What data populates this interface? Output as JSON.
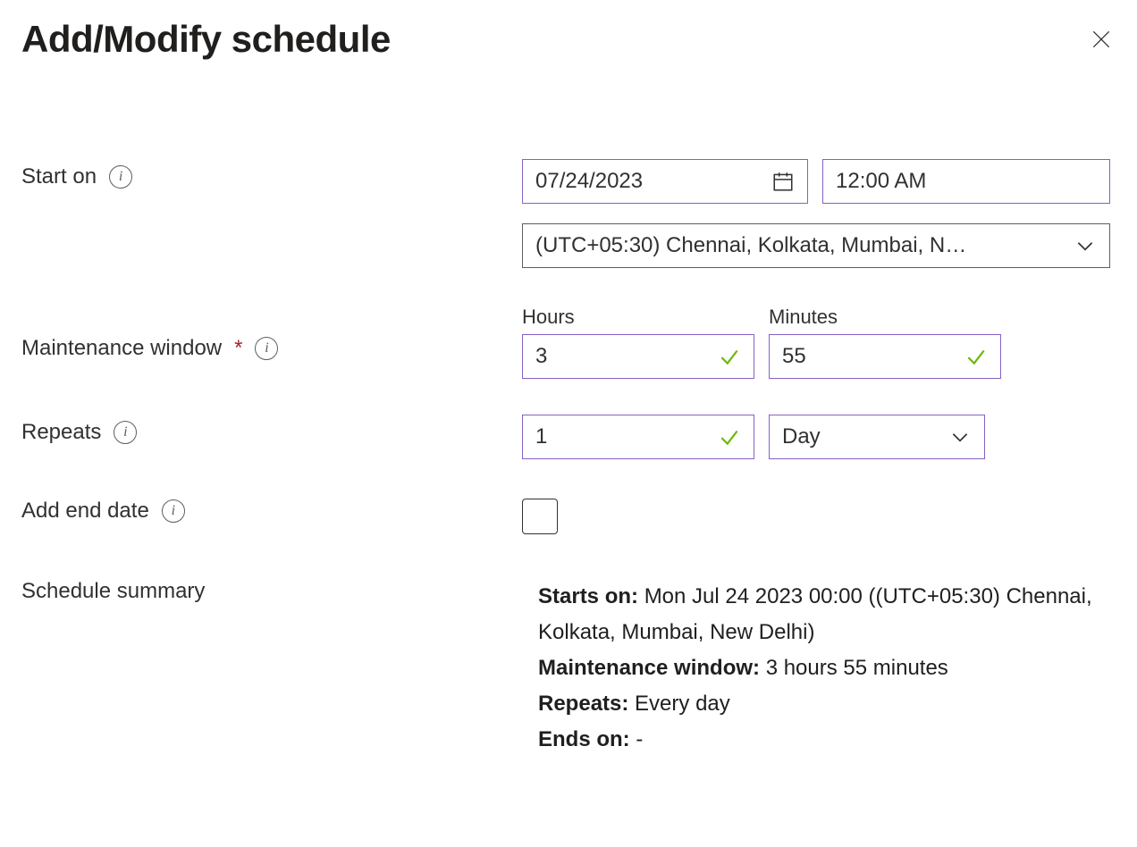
{
  "title": "Add/Modify schedule",
  "labels": {
    "start_on": "Start on",
    "maintenance_window": "Maintenance window",
    "repeats": "Repeats",
    "add_end_date": "Add end date",
    "schedule_summary": "Schedule summary",
    "hours": "Hours",
    "minutes": "Minutes",
    "required_marker": "*"
  },
  "values": {
    "date": "07/24/2023",
    "time": "12:00 AM",
    "timezone": "(UTC+05:30) Chennai, Kolkata, Mumbai, N…",
    "hours": "3",
    "minutes": "55",
    "repeat_count": "1",
    "repeat_unit": "Day",
    "add_end_date_checked": false
  },
  "summary": {
    "starts_on_label": "Starts on:",
    "starts_on_value": "Mon Jul 24 2023 00:00 ((UTC+05:30) Chennai, Kolkata, Mumbai, New Delhi)",
    "maintenance_label": "Maintenance window:",
    "maintenance_value": "3 hours 55 minutes",
    "repeats_label": "Repeats:",
    "repeats_value": "Every day",
    "ends_on_label": "Ends on:",
    "ends_on_value": "-"
  }
}
